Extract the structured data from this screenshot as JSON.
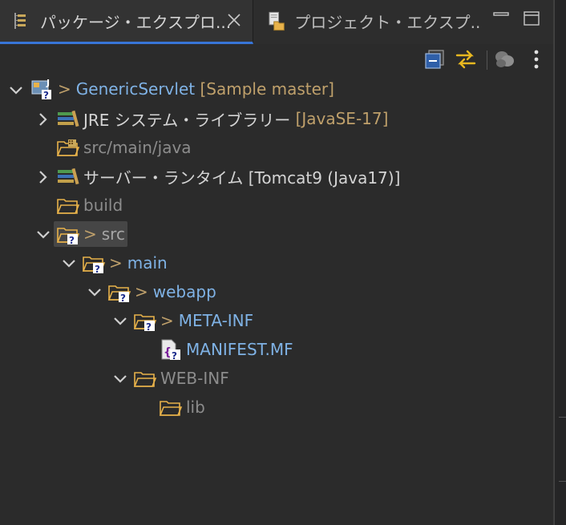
{
  "tabs": [
    {
      "label": "パッケージ・エクスプロ...",
      "active": true
    },
    {
      "label": "プロジェクト・エクスプ...",
      "active": false
    }
  ],
  "colors": {
    "accent": "#3875d7",
    "background": "#2b2b2b",
    "decoration": "#bfa06b",
    "link_text": "#7fb2e5"
  },
  "tree": {
    "project": {
      "arrow": ">",
      "name": "GenericServlet",
      "decoration": "[Sample master]"
    },
    "jre": {
      "name": "JRE システム・ライブラリー",
      "decoration": "[JavaSE-17]"
    },
    "src_main_java": {
      "name": "src/main/java"
    },
    "server_runtime": {
      "name": "サーバー・ランタイム [Tomcat9 (Java17)]"
    },
    "build": {
      "name": "build"
    },
    "src": {
      "arrow": ">",
      "name": "src"
    },
    "main": {
      "arrow": ">",
      "name": "main"
    },
    "webapp": {
      "arrow": ">",
      "name": "webapp"
    },
    "meta_inf": {
      "arrow": ">",
      "name": "META-INF"
    },
    "manifest": {
      "name": "MANIFEST.MF"
    },
    "web_inf": {
      "name": "WEB-INF"
    },
    "lib": {
      "name": "lib"
    }
  }
}
